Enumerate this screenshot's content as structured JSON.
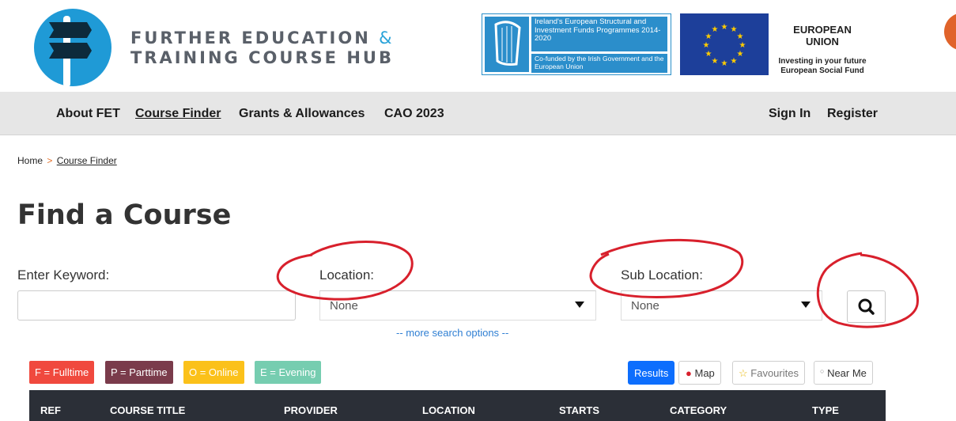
{
  "brand": {
    "line1": "FURTHER EDUCATION",
    "amp": "&",
    "line2": "TRAINING COURSE HUB"
  },
  "eu_funds": {
    "text1": "Ireland's European Structural and Investment Funds Programmes 2014-2020",
    "text2": "Co-funded by the Irish Government and the European Union"
  },
  "eu": {
    "title": "EUROPEAN UNION",
    "sub1": "Investing in your future",
    "sub2": "European Social Fund"
  },
  "nav": {
    "items": [
      {
        "label": "About FET"
      },
      {
        "label": "Course Finder",
        "active": true
      },
      {
        "label": "Grants & Allowances"
      },
      {
        "label": "CAO 2023"
      }
    ],
    "sign_in": "Sign In",
    "register": "Register"
  },
  "breadcrumb": {
    "home": "Home",
    "sep": ">",
    "current": "Course Finder"
  },
  "page_title": "Find a Course",
  "search": {
    "keyword_label": "Enter Keyword:",
    "keyword_value": "",
    "location_label": "Location:",
    "location_value": "None",
    "sublocation_label": "Sub Location:",
    "sublocation_value": "None",
    "more_options": "-- more search options --"
  },
  "legend": [
    {
      "label": "F = Fulltime",
      "color": "#f0493e"
    },
    {
      "label": "P = Parttime",
      "color": "#7a3b4b"
    },
    {
      "label": "O = Online",
      "color": "#fbc11a"
    },
    {
      "label": "E = Evening",
      "color": "#76cdb0"
    }
  ],
  "view_buttons": {
    "results": "Results",
    "map": "Map",
    "favourites": "Favourites",
    "near_me": "Near Me"
  },
  "table": {
    "columns": [
      "REF",
      "COURSE TITLE",
      "PROVIDER",
      "LOCATION",
      "STARTS",
      "CATEGORY",
      "TYPE"
    ]
  },
  "colors": {
    "accent": "#2aa3d9",
    "results_btn": "#0d6efd",
    "header_bg": "#2b2f37",
    "annotation": "#d8202c"
  }
}
